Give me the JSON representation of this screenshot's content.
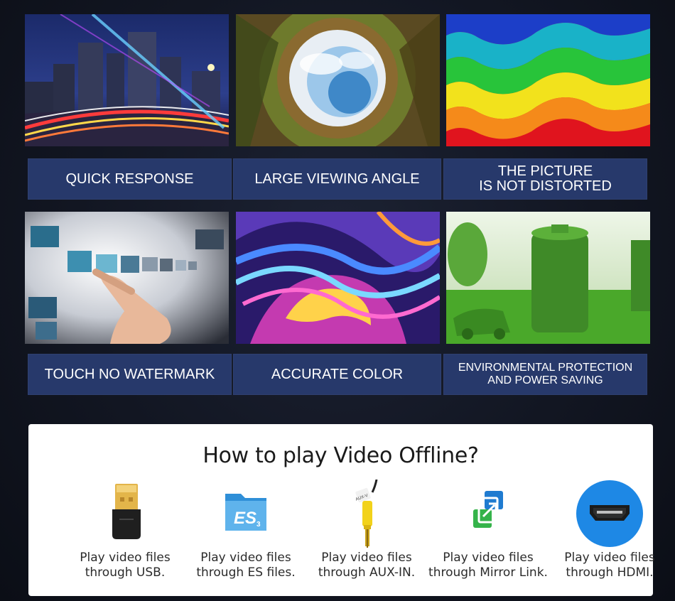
{
  "features": [
    {
      "lines": [
        "QUICK RESPONSE"
      ],
      "image": "city-light-trails-image"
    },
    {
      "lines": [
        "LARGE VIEWING ANGLE"
      ],
      "image": "fisheye-landscape-image"
    },
    {
      "lines": [
        "THE PICTURE",
        "IS NOT DISTORTED"
      ],
      "image": "rainbow-waves-image"
    },
    {
      "lines": [
        "TOUCH NO WATERMARK"
      ],
      "image": "touch-screen-hand-image"
    },
    {
      "lines": [
        "ACCURATE COLOR"
      ],
      "image": "colorful-swirl-image"
    },
    {
      "lines": [
        "ENVIRONMENTAL PROTECTION",
        "AND POWER SAVING"
      ],
      "image": "grass-battery-image"
    }
  ],
  "offline": {
    "title": "How to play Video Offline?",
    "options": [
      {
        "icon": "usb-dongle-icon",
        "line1": "Play video files",
        "line2": "through USB."
      },
      {
        "icon": "es-file-explorer-icon",
        "line1": "Play video files",
        "line2": "through ES files."
      },
      {
        "icon": "aux-rca-cable-icon",
        "line1": "Play video files",
        "line2": "through AUX-IN."
      },
      {
        "icon": "mirror-link-icon",
        "line1": "Play video files",
        "line2": "through Mirror Link."
      },
      {
        "icon": "hdmi-port-icon",
        "line1": "Play video files",
        "line2": "through HDMI."
      }
    ]
  },
  "colors": {
    "label_bg": "#27396b",
    "hdmi_circle": "#1e88e5",
    "mirror_blue": "#1f7bd0",
    "mirror_green": "#35b34a"
  },
  "icon_text": {
    "es_logo": "ES",
    "es_sub": "3",
    "aux_tag": "AUX-V"
  }
}
